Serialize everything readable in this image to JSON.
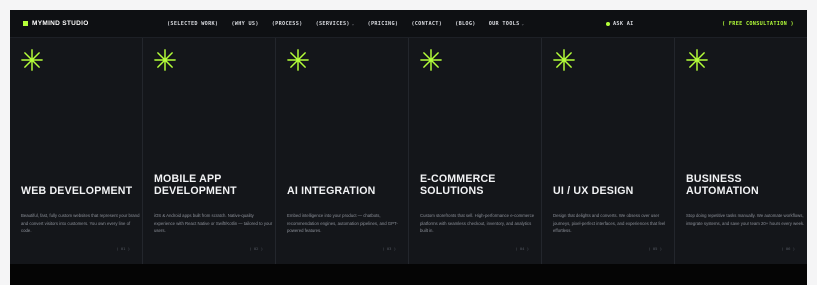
{
  "nav": {
    "brand": "MYMIND STUDIO",
    "items": [
      {
        "label": "(SELECTED WORK)",
        "dropdown": false
      },
      {
        "label": "(WHY US)",
        "dropdown": false
      },
      {
        "label": "(PROCESS)",
        "dropdown": false
      },
      {
        "label": "(SERVICES)",
        "dropdown": true
      },
      {
        "label": "(PRICING)",
        "dropdown": false
      },
      {
        "label": "(CONTACT)",
        "dropdown": false
      },
      {
        "label": "(BLOG)",
        "dropdown": false
      },
      {
        "label": "OUR TOOLS",
        "dropdown": true
      }
    ],
    "ask_ai": "ASK AI",
    "cta": "( FREE CONSULTATION )"
  },
  "colors": {
    "accent": "#b4ff39",
    "card_bg": "#14161a",
    "page_bg": "#0b0c0f"
  },
  "cards": [
    {
      "title": "WEB DEVELOPMENT",
      "desc": "Beautiful, fast, fully custom websites that represent your brand and convert visitors into customers. You own every line of code.",
      "num": "( 01 )",
      "icon": "asterisk-icon"
    },
    {
      "title": "MOBILE APP DEVELOPMENT",
      "desc": "iOS & Android apps built from scratch. Native-quality experience with React Native or Swift/Kotlin — tailored to your users.",
      "num": "( 02 )",
      "icon": "asterisk-icon"
    },
    {
      "title": "AI INTEGRATION",
      "desc": "Embed intelligence into your product — chatbots, recommendation engines, automation pipelines, and GPT-powered features.",
      "num": "( 03 )",
      "icon": "asterisk-icon"
    },
    {
      "title": "E-COMMERCE SOLUTIONS",
      "desc": "Custom storefronts that sell. High-performance e-commerce platforms with seamless checkout, inventory, and analytics built in.",
      "num": "( 04 )",
      "icon": "asterisk-icon"
    },
    {
      "title": "UI / UX DESIGN",
      "desc": "Design that delights and converts. We obsess over user journeys, pixel-perfect interfaces, and experiences that feel effortless.",
      "num": "( 05 )",
      "icon": "asterisk-icon"
    },
    {
      "title": "BUSINESS AUTOMATION",
      "desc": "Stop doing repetitive tasks manually. We automate workflows, integrate systems, and save your team 20+ hours every week.",
      "num": "( 06 )",
      "icon": "asterisk-icon"
    }
  ]
}
